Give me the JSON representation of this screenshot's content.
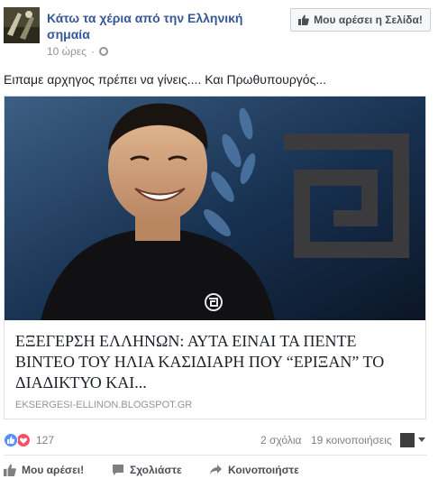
{
  "header": {
    "page_name": "Κάτω τα χέρια από την Ελληνική σημαία",
    "timestamp": "10 ώρες",
    "separator": "·",
    "privacy_icon": "globe-icon",
    "like_page_button": "Μου αρέσει η Σελίδα!"
  },
  "post": {
    "text": "Ειπαμε αρχηγος πρέπει να γίνεις.... Και Πρωθυπουργός..."
  },
  "attachment": {
    "title": "ΕΞΕΓΕΡΣΗ ΕΛΛΗΝΩΝ: ΑΥΤΑ ΕΙΝΑΙ ΤΑ ΠΕΝΤΕ ΒΙΝΤΕΟ ΤΟΥ ΗΛΙΑ ΚΑΣΙΔΙΑΡΗ ΠΟΥ “ΕΡΙΞΑΝ” ΤΟ ΔΙΑΔΙΚΤΥΟ ΚΑΙ...",
    "domain": "EKSERGESI-ELLINON.BLOGSPOT.GR"
  },
  "stats": {
    "reactions_count": "127",
    "reaction_icons": [
      "like-icon",
      "love-icon"
    ],
    "comments": "2 σχόλια",
    "shares": "19 κοινοποιήσεις"
  },
  "actions": {
    "like": "Μου αρέσει!",
    "comment": "Σχολιάστε",
    "share": "Κοινοποιήστε"
  },
  "colors": {
    "link_blue": "#365899",
    "meta_gray": "#90949c",
    "like_blue": "#5890ff",
    "love_red": "#f25268"
  }
}
